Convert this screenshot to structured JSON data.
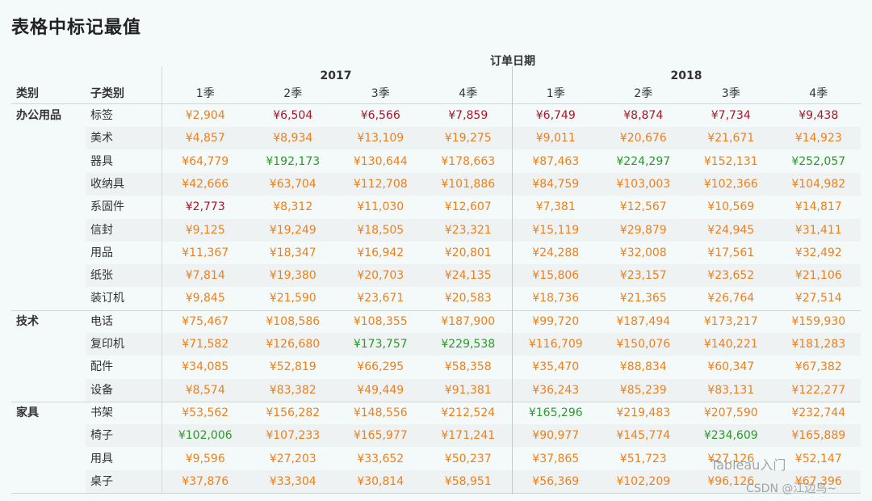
{
  "title": "表格中标记最值",
  "headers": {
    "top": "订单日期",
    "category": "类别",
    "subcategory": "子类别",
    "years": [
      "2017",
      "2018"
    ],
    "quarters": [
      "1季",
      "2季",
      "3季",
      "4季",
      "1季",
      "2季",
      "3季",
      "4季"
    ]
  },
  "colors": {
    "max": "#2a9a2a",
    "min": "#b01325",
    "normal": "#f07f1a"
  },
  "groups": [
    {
      "category": "办公用品",
      "rows": [
        {
          "sub": "标签",
          "values": [
            "¥2,904",
            "¥6,504",
            "¥6,566",
            "¥7,859",
            "¥6,749",
            "¥8,874",
            "¥7,734",
            "¥9,438"
          ],
          "flags": [
            "n",
            "min",
            "min",
            "min",
            "min",
            "min",
            "min",
            "min"
          ]
        },
        {
          "sub": "美术",
          "values": [
            "¥4,857",
            "¥8,934",
            "¥13,109",
            "¥19,275",
            "¥9,011",
            "¥20,676",
            "¥21,671",
            "¥14,923"
          ],
          "flags": [
            "n",
            "n",
            "n",
            "n",
            "n",
            "n",
            "n",
            "n"
          ]
        },
        {
          "sub": "器具",
          "values": [
            "¥64,779",
            "¥192,173",
            "¥130,644",
            "¥178,663",
            "¥87,463",
            "¥224,297",
            "¥152,131",
            "¥252,057"
          ],
          "flags": [
            "n",
            "max",
            "n",
            "n",
            "n",
            "max",
            "n",
            "max"
          ]
        },
        {
          "sub": "收纳具",
          "values": [
            "¥42,666",
            "¥63,704",
            "¥112,708",
            "¥101,886",
            "¥84,759",
            "¥103,003",
            "¥102,366",
            "¥104,982"
          ],
          "flags": [
            "n",
            "n",
            "n",
            "n",
            "n",
            "n",
            "n",
            "n"
          ]
        },
        {
          "sub": "系固件",
          "values": [
            "¥2,773",
            "¥8,312",
            "¥11,030",
            "¥12,607",
            "¥7,381",
            "¥12,567",
            "¥10,569",
            "¥14,817"
          ],
          "flags": [
            "min",
            "n",
            "n",
            "n",
            "n",
            "n",
            "n",
            "n"
          ]
        },
        {
          "sub": "信封",
          "values": [
            "¥9,125",
            "¥19,249",
            "¥18,505",
            "¥23,321",
            "¥15,119",
            "¥29,879",
            "¥24,945",
            "¥31,411"
          ],
          "flags": [
            "n",
            "n",
            "n",
            "n",
            "n",
            "n",
            "n",
            "n"
          ]
        },
        {
          "sub": "用品",
          "values": [
            "¥11,367",
            "¥18,347",
            "¥16,942",
            "¥20,801",
            "¥24,288",
            "¥32,008",
            "¥17,561",
            "¥32,492"
          ],
          "flags": [
            "n",
            "n",
            "n",
            "n",
            "n",
            "n",
            "n",
            "n"
          ]
        },
        {
          "sub": "纸张",
          "values": [
            "¥7,814",
            "¥19,380",
            "¥20,703",
            "¥24,135",
            "¥15,806",
            "¥23,157",
            "¥23,652",
            "¥21,106"
          ],
          "flags": [
            "n",
            "n",
            "n",
            "n",
            "n",
            "n",
            "n",
            "n"
          ]
        },
        {
          "sub": "装订机",
          "values": [
            "¥9,845",
            "¥21,590",
            "¥23,671",
            "¥20,583",
            "¥18,736",
            "¥21,365",
            "¥26,764",
            "¥27,514"
          ],
          "flags": [
            "n",
            "n",
            "n",
            "n",
            "n",
            "n",
            "n",
            "n"
          ]
        }
      ]
    },
    {
      "category": "技术",
      "rows": [
        {
          "sub": "电话",
          "values": [
            "¥75,467",
            "¥108,586",
            "¥108,355",
            "¥187,900",
            "¥99,720",
            "¥187,494",
            "¥173,217",
            "¥159,930"
          ],
          "flags": [
            "n",
            "n",
            "n",
            "n",
            "n",
            "n",
            "n",
            "n"
          ]
        },
        {
          "sub": "复印机",
          "values": [
            "¥71,582",
            "¥126,680",
            "¥173,757",
            "¥229,538",
            "¥116,709",
            "¥150,076",
            "¥140,221",
            "¥181,283"
          ],
          "flags": [
            "n",
            "n",
            "max",
            "max",
            "n",
            "n",
            "n",
            "n"
          ]
        },
        {
          "sub": "配件",
          "values": [
            "¥34,085",
            "¥52,819",
            "¥66,295",
            "¥58,358",
            "¥35,470",
            "¥88,834",
            "¥60,347",
            "¥67,382"
          ],
          "flags": [
            "n",
            "n",
            "n",
            "n",
            "n",
            "n",
            "n",
            "n"
          ]
        },
        {
          "sub": "设备",
          "values": [
            "¥8,574",
            "¥83,382",
            "¥49,449",
            "¥91,381",
            "¥36,243",
            "¥85,239",
            "¥83,131",
            "¥122,277"
          ],
          "flags": [
            "n",
            "n",
            "n",
            "n",
            "n",
            "n",
            "n",
            "n"
          ]
        }
      ]
    },
    {
      "category": "家具",
      "rows": [
        {
          "sub": "书架",
          "values": [
            "¥53,562",
            "¥156,282",
            "¥148,556",
            "¥212,524",
            "¥165,296",
            "¥219,483",
            "¥207,590",
            "¥232,744"
          ],
          "flags": [
            "n",
            "n",
            "n",
            "n",
            "max",
            "n",
            "n",
            "n"
          ]
        },
        {
          "sub": "椅子",
          "values": [
            "¥102,006",
            "¥107,233",
            "¥165,977",
            "¥171,241",
            "¥90,977",
            "¥145,774",
            "¥234,609",
            "¥165,889"
          ],
          "flags": [
            "max",
            "n",
            "n",
            "n",
            "n",
            "n",
            "max",
            "n"
          ]
        },
        {
          "sub": "用具",
          "values": [
            "¥9,596",
            "¥27,203",
            "¥33,652",
            "¥50,237",
            "¥37,865",
            "¥51,723",
            "¥27,126",
            "¥52,147"
          ],
          "flags": [
            "n",
            "n",
            "n",
            "n",
            "n",
            "n",
            "n",
            "n"
          ]
        },
        {
          "sub": "桌子",
          "values": [
            "¥37,876",
            "¥33,304",
            "¥30,814",
            "¥58,951",
            "¥56,369",
            "¥102,209",
            "¥96,126",
            "¥67,396"
          ],
          "flags": [
            "n",
            "n",
            "n",
            "n",
            "n",
            "n",
            "n",
            "n"
          ]
        }
      ]
    }
  ],
  "watermark": {
    "line1": "Tableau入门",
    "line2": "CSDN @江边鸟~"
  }
}
